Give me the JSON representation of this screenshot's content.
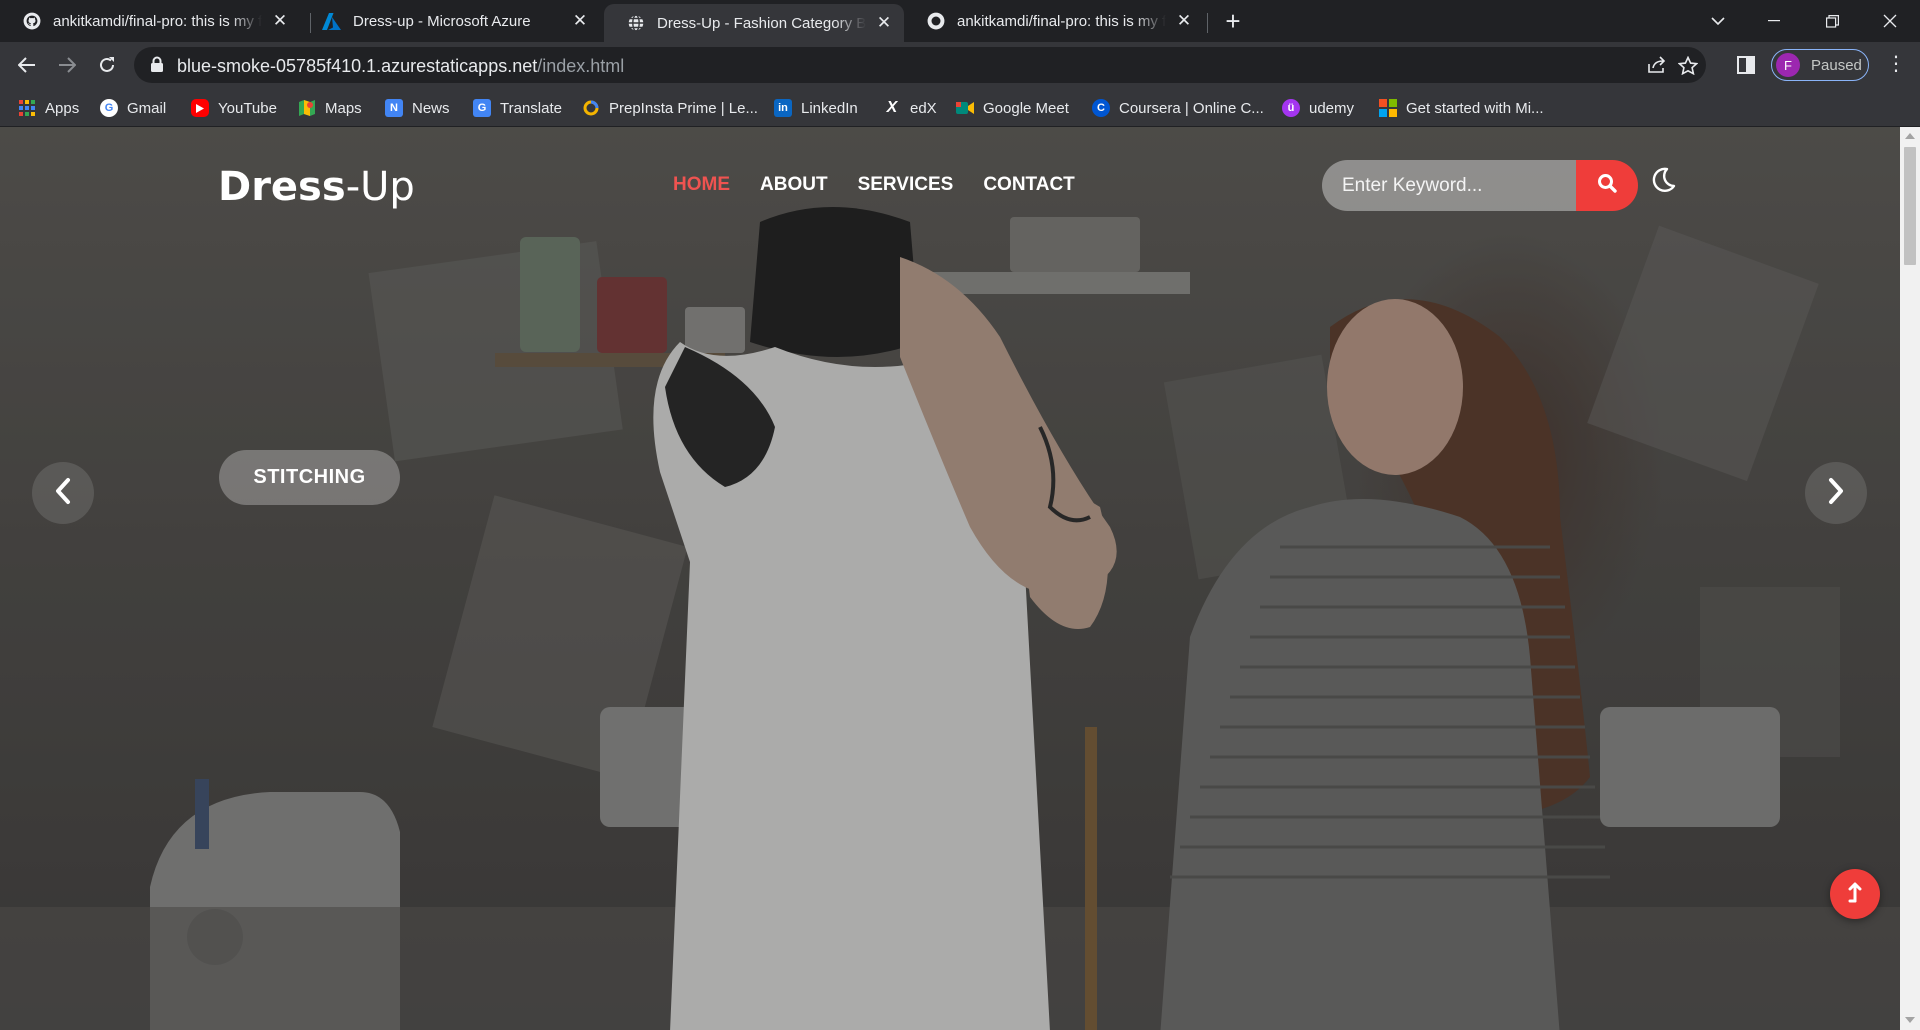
{
  "browser": {
    "tabs": [
      {
        "title": "ankitkamdi/final-pro: this is my fi",
        "icon": "github-icon",
        "active": false
      },
      {
        "title": "Dress-up - Microsoft Azure",
        "icon": "azure-icon",
        "active": false
      },
      {
        "title": "Dress-Up - Fashion Category Boo",
        "icon": "globe-icon",
        "active": true
      },
      {
        "title": "ankitkamdi/final-pro: this is my fi",
        "icon": "github-icon",
        "active": false
      }
    ],
    "url_host": "blue-smoke-05785f410.1.azurestaticapps.net",
    "url_path": "/index.html",
    "profile_initial": "F",
    "profile_status": "Paused",
    "bookmarks": [
      {
        "label": "Apps",
        "icon": "apps-grid-icon",
        "color": "#4285f4"
      },
      {
        "label": "Gmail",
        "icon": "google-icon",
        "color": "#ffffff"
      },
      {
        "label": "YouTube",
        "icon": "youtube-icon",
        "color": "#ff0000"
      },
      {
        "label": "Maps",
        "icon": "maps-icon",
        "color": "#34a853"
      },
      {
        "label": "News",
        "icon": "news-icon",
        "color": "#4285f4"
      },
      {
        "label": "Translate",
        "icon": "translate-icon",
        "color": "#4285f4"
      },
      {
        "label": "PrepInsta Prime | Le...",
        "icon": "prepinsta-icon",
        "color": "#f4b400"
      },
      {
        "label": "LinkedIn",
        "icon": "linkedin-icon",
        "color": "#0a66c2"
      },
      {
        "label": "edX",
        "icon": "edx-icon",
        "color": "#ffffff"
      },
      {
        "label": "Google Meet",
        "icon": "meet-icon",
        "color": "#00897b"
      },
      {
        "label": "Coursera | Online C...",
        "icon": "coursera-icon",
        "color": "#0056d2"
      },
      {
        "label": "udemy",
        "icon": "udemy-icon",
        "color": "#a435f0"
      },
      {
        "label": "Get started with Mi...",
        "icon": "microsoft-icon",
        "color": "#f25022"
      }
    ]
  },
  "site": {
    "logo_bold": "Dress",
    "logo_light": "-Up",
    "nav": [
      {
        "label": "HOME",
        "active": true
      },
      {
        "label": "ABOUT",
        "active": false
      },
      {
        "label": "SERVICES",
        "active": false
      },
      {
        "label": "CONTACT",
        "active": false
      }
    ],
    "search_placeholder": "Enter Keyword...",
    "slide_label": "STITCHING",
    "accent": "#ef3d3a"
  }
}
